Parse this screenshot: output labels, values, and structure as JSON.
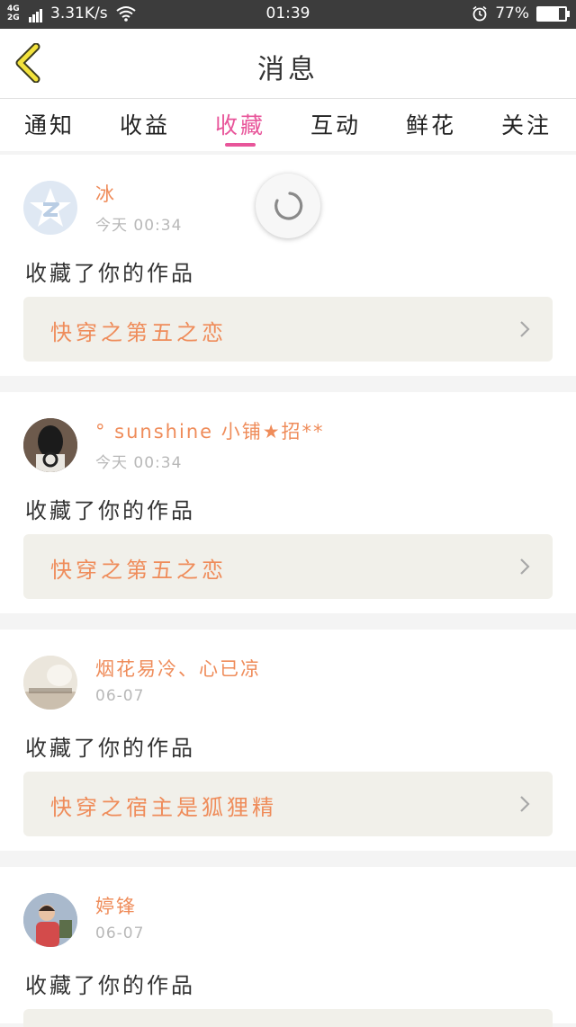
{
  "status_bar": {
    "network": "4G 2G",
    "speed": "3.31K/s",
    "time": "01:39",
    "battery": "77%",
    "battery_level": 0.77
  },
  "nav": {
    "title": "消息"
  },
  "tabs": [
    "通知",
    "收益",
    "收藏",
    "互动",
    "鲜花",
    "关注"
  ],
  "active_tab": "收藏",
  "colors": {
    "accent": "#e8559a",
    "name": "#ef8c5a",
    "work_bg": "#f1f0ea"
  },
  "messages": [
    {
      "user": "冰",
      "time": "今天 00:34",
      "action": "收藏了你的作品",
      "work": "快穿之第五之恋",
      "avatar_icon": "qzone-star-avatar"
    },
    {
      "user": "° sunshine 小铺★招**",
      "time": "今天 00:34",
      "action": "收藏了你的作品",
      "work": "快穿之第五之恋",
      "avatar_icon": "dark-portrait-avatar"
    },
    {
      "user": "烟花易冷、心已凉",
      "time": "06-07",
      "action": "收藏了你的作品",
      "work": "快穿之宿主是狐狸精",
      "avatar_icon": "text-photo-avatar"
    },
    {
      "user": "婷锋",
      "time": "06-07",
      "action": "收藏了你的作品",
      "work": "",
      "avatar_icon": "child-photo-avatar"
    }
  ]
}
